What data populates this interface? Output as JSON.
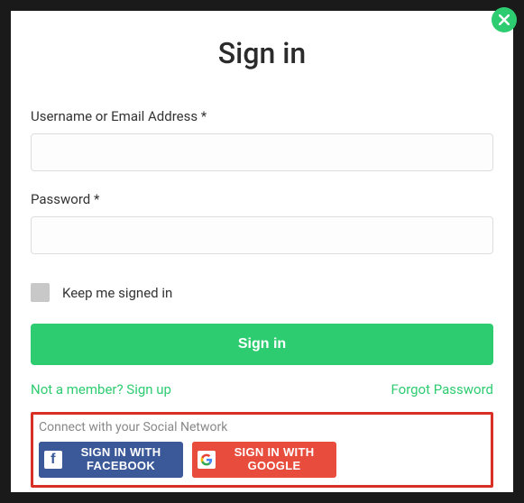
{
  "modal": {
    "title": "Sign in",
    "username_label": "Username or Email Address *",
    "password_label": "Password *",
    "keep_signed_label": "Keep me signed in",
    "signin_button": "Sign in",
    "signup_link": "Not a member? Sign up",
    "forgot_link": "Forgot Password"
  },
  "social": {
    "heading": "Connect with your Social Network",
    "facebook_label": "SIGN IN WITH FACEBOOK",
    "google_label": "SIGN IN WITH GOOGLE"
  },
  "colors": {
    "accent": "#2ecc71",
    "facebook": "#3b5998",
    "google": "#e74c3c",
    "highlight_border": "#d93025"
  }
}
